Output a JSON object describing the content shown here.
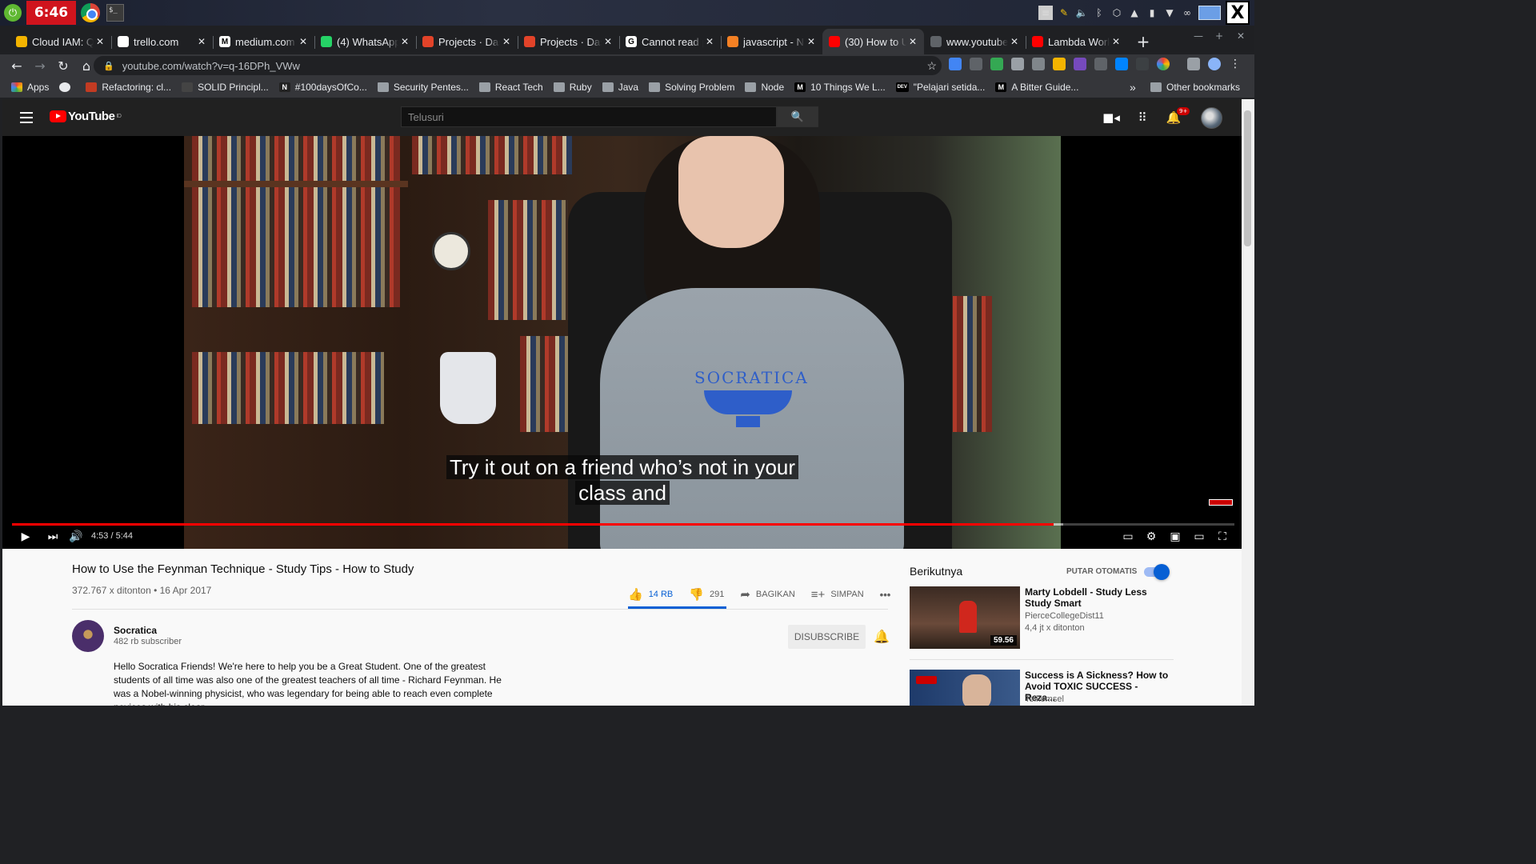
{
  "os": {
    "clock": "6:46",
    "launcher_icon": "launcher-icon",
    "tray_icons": [
      "notes-icon",
      "edit-icon",
      "volume-icon",
      "bluetooth-icon",
      "network-icon",
      "upload-icon",
      "battery-icon",
      "wifi-icon",
      "link-icon"
    ]
  },
  "tabs": [
    {
      "title": "Cloud IAM: Q",
      "favicon": "#f4b400",
      "letter": ""
    },
    {
      "title": "trello.com",
      "favicon": "#ffffff",
      "letter": ""
    },
    {
      "title": "medium.com",
      "favicon": "#ffffff",
      "letter": "M"
    },
    {
      "title": "(4) WhatsApp",
      "favicon": "#25d366",
      "letter": ""
    },
    {
      "title": "Projects · Das",
      "favicon": "#e24329",
      "letter": ""
    },
    {
      "title": "Projects · Das",
      "favicon": "#e24329",
      "letter": ""
    },
    {
      "title": "Cannot read p",
      "favicon": "#ffffff",
      "letter": "G"
    },
    {
      "title": "javascript - N",
      "favicon": "#f48024",
      "letter": ""
    },
    {
      "title": "(30) How to U",
      "favicon": "#ff0000",
      "letter": "",
      "active": true
    },
    {
      "title": "www.youtube",
      "favicon": "#5f6368",
      "letter": ""
    },
    {
      "title": "Lambda Work",
      "favicon": "#ff0000",
      "letter": ""
    }
  ],
  "toolbar": {
    "url": "youtube.com/watch?v=q-16DPh_VWw"
  },
  "bookmarks": {
    "items": [
      {
        "label": "Apps",
        "type": "apps"
      },
      {
        "label": "",
        "type": "github"
      },
      {
        "label": "Refactoring: cl...",
        "type": "site",
        "color": "#c23b22"
      },
      {
        "label": "SOLID Principl...",
        "type": "site",
        "color": "#444444"
      },
      {
        "label": "#100daysOfCo...",
        "type": "site",
        "color": "#222222",
        "letter": "N"
      },
      {
        "label": "Security Pentes...",
        "type": "folder"
      },
      {
        "label": "React Tech",
        "type": "folder"
      },
      {
        "label": "Ruby",
        "type": "folder"
      },
      {
        "label": "Java",
        "type": "folder"
      },
      {
        "label": "Solving Problem",
        "type": "folder"
      },
      {
        "label": "Node",
        "type": "folder"
      },
      {
        "label": "10 Things We L...",
        "type": "site",
        "color": "#000000",
        "letter": "M"
      },
      {
        "label": "\"Pelajari setida...",
        "type": "site",
        "color": "#000000",
        "letter": "DEV"
      },
      {
        "label": "A Bitter Guide...",
        "type": "site",
        "color": "#000000",
        "letter": "M"
      }
    ],
    "more": "»",
    "other": "Other bookmarks"
  },
  "youtube": {
    "logo_text": "YouTube",
    "logo_region": "ID",
    "search_placeholder": "Telusuri",
    "notification_count": "9+",
    "player": {
      "caption_line1": "Try it out on a friend who’s not in your",
      "caption_line2": "class and",
      "current_time": "4:53",
      "duration": "5:44",
      "time_display": "4:53 / 5:44",
      "progress_fraction": 0.852,
      "loaded_fraction": 0.86
    },
    "video": {
      "title": "How to Use the Feynman Technique - Study Tips - How to Study",
      "meta": "372.767 x ditonton • 16 Apr 2017",
      "likes": "14 RB",
      "dislikes": "291",
      "share_label": "BAGIKAN",
      "save_label": "SIMPAN",
      "more_label": "•••"
    },
    "channel": {
      "name": "Socratica",
      "subscribers": "482 rb subscriber",
      "unsubscribe_label": "DISUBSCRIBE",
      "description": "Hello Socratica Friends!  We're here to help you be a Great Student. One of the greatest students of all time was also one of the greatest teachers of all time - Richard Feynman.  He was a Nobel-winning physicist, who was legendary for being able to reach even complete novices with his clear,"
    },
    "brand_on_hoodie": "SOCRATICA",
    "up_next": {
      "heading": "Berikutnya",
      "autoplay_label": "PUTAR OTOMATIS",
      "autoplay_on": true,
      "items": [
        {
          "title": "Marty Lobdell - Study Less Study Smart",
          "channel": "PierceCollegeDist11",
          "views": "4,4 jt x ditonton",
          "duration": "59.56"
        },
        {
          "title": "Success is A Sickness? How to Avoid TOXIC SUCCESS - Reza...",
          "channel": "Telkomsel",
          "views": "",
          "duration": ""
        }
      ]
    }
  }
}
